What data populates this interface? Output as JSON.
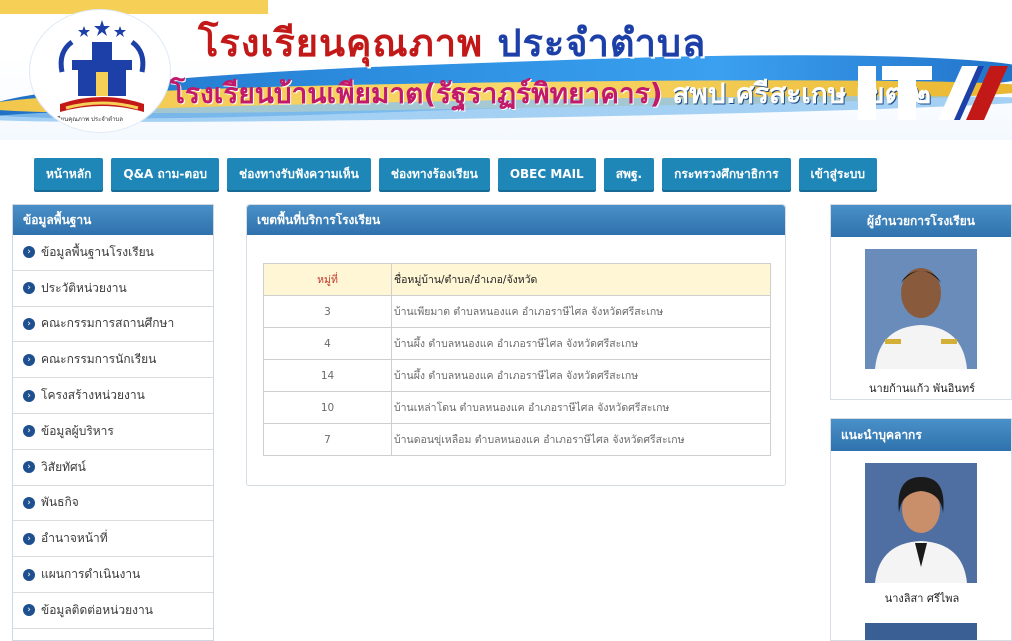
{
  "header": {
    "title_part1": "โรงเรียนคุณภาพ",
    "title_part2": "ประจำตำบล",
    "subtitle_part1": "โรงเรียนบ้านเพียมาต(รัฐราฏร์พิทยาคาร)",
    "subtitle_part2": "สพป.ศรีสะเกษ เขต ๒",
    "logo_caption": "โรงเรียนคุณภาพ ประจำตำบล",
    "badge_text": "ITA",
    "colors": {
      "title_red": "#c21818",
      "title_blue": "#1d3fa8",
      "accent_yellow": "#f6cf57",
      "banner_blue": "#2d8fe0"
    }
  },
  "nav": {
    "items": [
      {
        "label": "หน้าหลัก"
      },
      {
        "label": "Q&A ถาม-ตอบ"
      },
      {
        "label": "ช่องทางรับฟังความเห็น"
      },
      {
        "label": "ช่องทางร้องเรียน"
      },
      {
        "label": "OBEC MAIL"
      },
      {
        "label": "สพฐ."
      },
      {
        "label": "กระทรวงศึกษาธิการ"
      },
      {
        "label": "เข้าสู่ระบบ"
      }
    ],
    "color": "#1f86b8"
  },
  "sidebar": {
    "title": "ข้อมูลพื้นฐาน",
    "bullet_icon": "chevron-right-circle-icon",
    "items": [
      {
        "label": "ข้อมูลพื้นฐานโรงเรียน"
      },
      {
        "label": "ประวัติหน่วยงาน"
      },
      {
        "label": "คณะกรรมการสถานศึกษา"
      },
      {
        "label": "คณะกรรมการนักเรียน"
      },
      {
        "label": "โครงสร้างหน่วยงาน"
      },
      {
        "label": "ข้อมูลผู้บริหาร"
      },
      {
        "label": "วิสัยทัศน์"
      },
      {
        "label": "พันธกิจ"
      },
      {
        "label": "อำนาจหน้าที่"
      },
      {
        "label": "แผนการดำเนินงาน"
      },
      {
        "label": "ข้อมูลติดต่อหน่วยงาน"
      }
    ]
  },
  "main": {
    "title": "เขตพื้นที่บริการโรงเรียน",
    "table": {
      "headers": [
        "หมู่ที่",
        "ชื่อหมู่บ้าน/ตำบล/อำเภอ/จังหวัด"
      ],
      "rows": [
        {
          "no": "3",
          "name": "บ้านเพียมาต ตำบลหนองแค อำเภอราษีไศล จังหวัดศรีสะเกษ"
        },
        {
          "no": "4",
          "name": "บ้านผึ้ง ตำบลหนองแค อำเภอราษีไศล จังหวัดศรีสะเกษ"
        },
        {
          "no": "14",
          "name": "บ้านผึ้ง ตำบลหนองแค อำเภอราษีไศล จังหวัดศรีสะเกษ"
        },
        {
          "no": "10",
          "name": "บ้านเหล่าโดน ตำบลหนองแค อำเภอราษีไศล จังหวัดศรีสะเกษ"
        },
        {
          "no": "7",
          "name": "บ้านดอนขุ่เหลือม ตำบลหนองแค อำเภอราษีไศล จังหวัดศรีสะเกษ"
        }
      ]
    }
  },
  "right": {
    "director": {
      "title": "ผู้อำนวยการโรงเรียน",
      "name": "นายก้านแก้ว พันอินทร์"
    },
    "staff": {
      "title": "แนะนำบุคลากร",
      "name": "นางลิสา ศรีไพล"
    }
  }
}
